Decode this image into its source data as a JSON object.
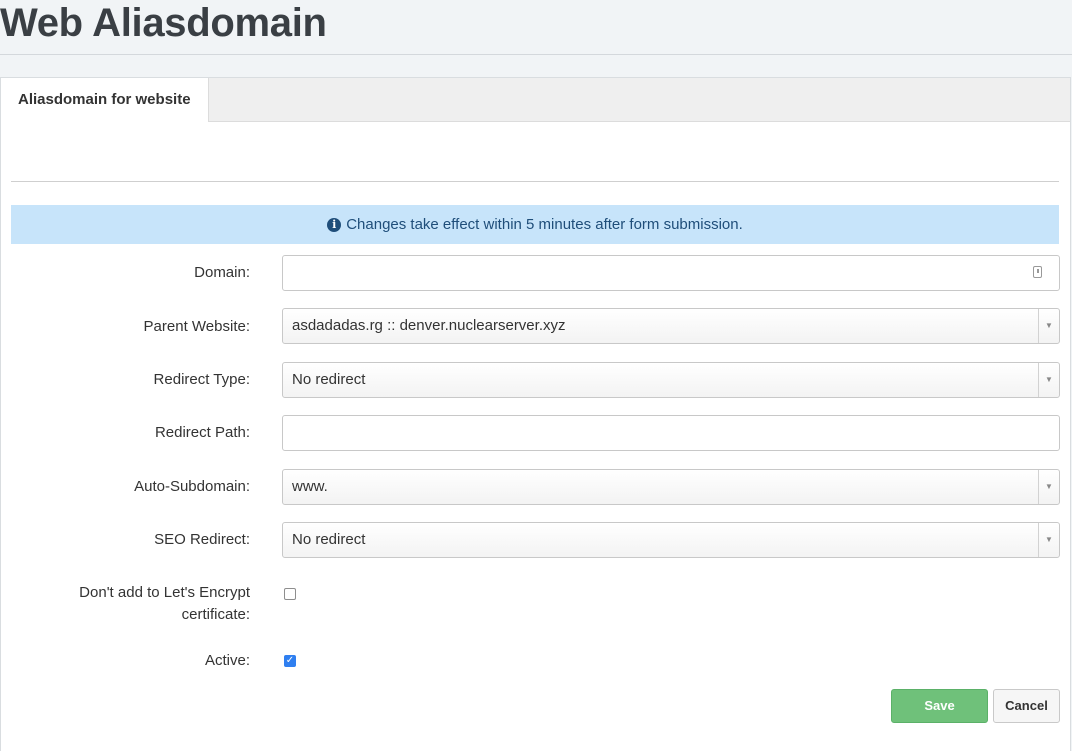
{
  "page": {
    "title": "Web Aliasdomain"
  },
  "tabs": [
    {
      "label": "Aliasdomain for website",
      "active": true
    }
  ],
  "info_message": "Changes take effect within 5 minutes after form submission.",
  "form": {
    "domain": {
      "label": "Domain:",
      "value": ""
    },
    "parent_website": {
      "label": "Parent Website:",
      "value": "asdadadas.rg :: denver.nuclearserver.xyz"
    },
    "redirect_type": {
      "label": "Redirect Type:",
      "value": "No redirect"
    },
    "redirect_path": {
      "label": "Redirect Path:",
      "value": ""
    },
    "auto_subdomain": {
      "label": "Auto-Subdomain:",
      "value": "www."
    },
    "seo_redirect": {
      "label": "SEO Redirect:",
      "value": "No redirect"
    },
    "no_letsencrypt": {
      "label_line1": "Don't add to Let's Encrypt",
      "label_line2": "certificate:",
      "checked": false
    },
    "active": {
      "label": "Active:",
      "checked": true
    }
  },
  "buttons": {
    "save": "Save",
    "cancel": "Cancel"
  },
  "colors": {
    "save_button": "#6fc17a",
    "info_bg": "#c7e4fa",
    "checkbox_checked": "#2f7ff0"
  },
  "icons": {
    "info": "info-circle-icon",
    "domain_field": "contact-card-icon",
    "select_arrow": "caret-down-icon"
  }
}
